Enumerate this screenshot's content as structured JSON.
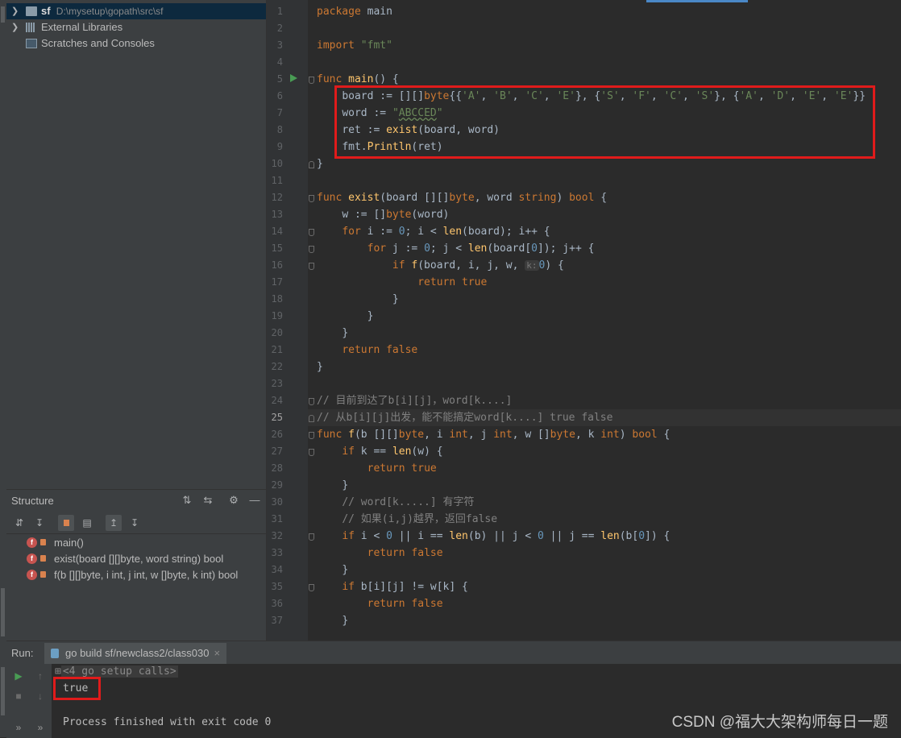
{
  "project": {
    "items": [
      {
        "label": "sf",
        "path": "D:\\mysetup\\gopath\\src\\sf"
      },
      {
        "label": "External Libraries"
      },
      {
        "label": "Scratches and Consoles"
      }
    ]
  },
  "structure": {
    "title": "Structure",
    "items": [
      {
        "badge": "f",
        "label": "main()"
      },
      {
        "badge": "f",
        "label": "exist(board [][]byte, word string) bool"
      },
      {
        "badge": "f",
        "label": "f(b [][]byte, i int, j int, w []byte, k int) bool"
      }
    ]
  },
  "editor": {
    "current_line": 25,
    "line_numbers": [
      "1",
      "2",
      "3",
      "4",
      "5",
      "6",
      "7",
      "8",
      "9",
      "10",
      "11",
      "12",
      "13",
      "14",
      "15",
      "16",
      "17",
      "18",
      "19",
      "20",
      "21",
      "22",
      "23",
      "24",
      "25",
      "26",
      "27",
      "28",
      "29",
      "30",
      "31",
      "32",
      "33",
      "34",
      "35",
      "36",
      "37"
    ],
    "inlay_hint_k": "k:",
    "lines": {
      "l1": {
        "a": "package",
        "b": " main"
      },
      "l3": {
        "a": "import",
        "b": "\"fmt\""
      },
      "l5": {
        "a": "func ",
        "b": "main",
        "c": "() {"
      },
      "l6": {
        "a": "board := [][]",
        "b": "byte",
        "c": "{{",
        "d": "'A'",
        "e": ", ",
        "f": "'B'",
        "g": ", ",
        "h": "'C'",
        "i": ", ",
        "j": "'E'",
        "k": "}, {",
        "l": "'S'",
        "m": ", ",
        "n": "'F'",
        "o": ", ",
        "p": "'C'",
        "q": ", ",
        "r": "'S'",
        "s": "}, {",
        "t": "'A'",
        "u": ", ",
        "v": "'D'",
        "w": ", ",
        "x": "'E'",
        "y": ", ",
        "z": "'E'",
        "z2": "}}"
      },
      "l7": {
        "a": "word := ",
        "b": "\"",
        "c": "ABCCED",
        "d": "\""
      },
      "l8": {
        "a": "ret := ",
        "b": "exist",
        "c": "(board, word)"
      },
      "l9": {
        "a": "fmt.",
        "b": "Println",
        "c": "(ret)"
      },
      "l10": "}",
      "l12": {
        "a": "func ",
        "b": "exist",
        "c": "(board [][]",
        "d": "byte",
        "e": ", word ",
        "f": "string",
        "g": ") ",
        "h": "bool",
        "i": " {"
      },
      "l13": {
        "a": "w := []",
        "b": "byte",
        "c": "(word)"
      },
      "l14": {
        "a": "for",
        "b": " i := ",
        "c": "0",
        "d": "; i < ",
        "e": "len",
        "f": "(board); i++ {"
      },
      "l15": {
        "a": "for",
        "b": " j := ",
        "c": "0",
        "d": "; j < ",
        "e": "len",
        "f": "(board[",
        "g": "0",
        "h": "]); j++ {"
      },
      "l16": {
        "a": "if ",
        "b": "f",
        "c": "(board, i, j, w, ",
        "d": "0",
        "e": ") {"
      },
      "l17": {
        "a": "return ",
        "b": "true"
      },
      "l18": "}",
      "l19": "}",
      "l20": "}",
      "l21": {
        "a": "return ",
        "b": "false"
      },
      "l22": "}",
      "l24": "// 目前到达了b[i][j]，word[k....]",
      "l25": "// 从b[i][j]出发，能不能搞定word[k....] true false",
      "l26": {
        "a": "func ",
        "b": "f",
        "c": "(b [][]",
        "d": "byte",
        "e": ", i ",
        "f": "int",
        "g": ", j ",
        "h": "int",
        "i": ", w []",
        "j": "byte",
        "k": ", k ",
        "l": "int",
        "m": ") ",
        "n": "bool",
        "o": " {"
      },
      "l27": {
        "a": "if ",
        "b": "k == ",
        "c": "len",
        "d": "(w) {"
      },
      "l28": {
        "a": "return ",
        "b": "true"
      },
      "l29": "}",
      "l30": "// word[k.....] 有字符",
      "l31": "// 如果(i,j)越界，返回false",
      "l32": {
        "a": "if ",
        "b": "i < ",
        "c": "0",
        "d": " || i == ",
        "e": "len",
        "f": "(b) || j < ",
        "g": "0",
        "h": " || j == ",
        "i": "len",
        "j": "(b[",
        "k": "0",
        "l": "]) {"
      },
      "l33": {
        "a": "return ",
        "b": "false"
      },
      "l34": "}",
      "l35": {
        "a": "if ",
        "b": "b[i][j] != w[k] {"
      },
      "l36": {
        "a": "return ",
        "b": "false"
      },
      "l37": "}"
    }
  },
  "run": {
    "label": "Run:",
    "tab": "go build sf/newclass2/class030",
    "tab_close": "×",
    "setup_calls": "<4 go setup calls>",
    "output": "true",
    "exit": "Process finished with exit code 0"
  },
  "watermark": "CSDN @福大大架构师每日一题",
  "colors": {
    "highlight_box": "#e01b1b",
    "keyword": "#cc7832",
    "string": "#6a8759",
    "number": "#6897bb",
    "function": "#ffc66d"
  }
}
